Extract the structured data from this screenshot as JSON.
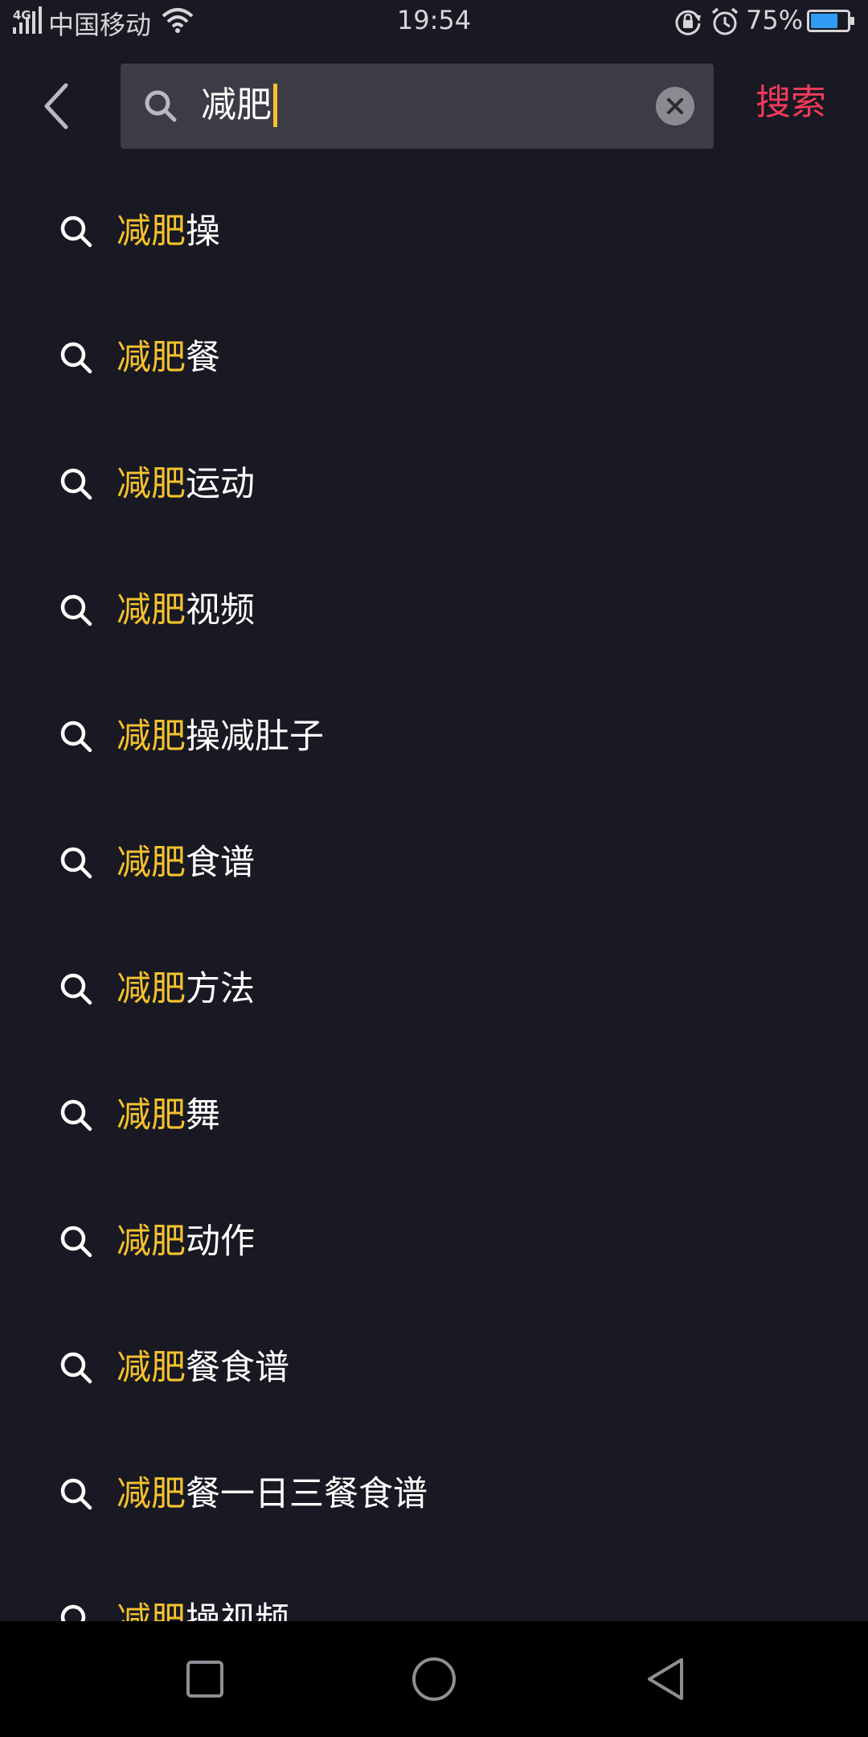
{
  "status_bar": {
    "network": "4G",
    "carrier": "中国移动",
    "time": "19:54",
    "battery_percent": "75%",
    "battery_level": 0.75,
    "icons": [
      "signal-icon",
      "wifi-icon",
      "rotation-lock-icon",
      "alarm-icon",
      "battery-icon"
    ]
  },
  "search": {
    "query": "减肥",
    "submit_label": "搜索",
    "icons": [
      "back-chevron-icon",
      "search-icon",
      "clear-icon"
    ]
  },
  "suggestions": [
    {
      "match": "减肥",
      "rest": "操"
    },
    {
      "match": "减肥",
      "rest": "餐"
    },
    {
      "match": "减肥",
      "rest": "运动"
    },
    {
      "match": "减肥",
      "rest": "视频"
    },
    {
      "match": "减肥",
      "rest": "操减肚子"
    },
    {
      "match": "减肥",
      "rest": "食谱"
    },
    {
      "match": "减肥",
      "rest": "方法"
    },
    {
      "match": "减肥",
      "rest": "舞"
    },
    {
      "match": "减肥",
      "rest": "动作"
    },
    {
      "match": "减肥",
      "rest": "餐食谱"
    },
    {
      "match": "减肥",
      "rest": "餐一日三餐食谱"
    },
    {
      "match": "减肥",
      "rest": "操视频"
    }
  ],
  "nav_bar": {
    "icons": [
      "recents-square-icon",
      "home-circle-icon",
      "back-triangle-icon"
    ]
  },
  "colors": {
    "background": "#181922",
    "search_box": "#3b3c45",
    "highlight": "#f6c22d",
    "submit": "#f03a5c",
    "nav_bar": "#000000"
  }
}
